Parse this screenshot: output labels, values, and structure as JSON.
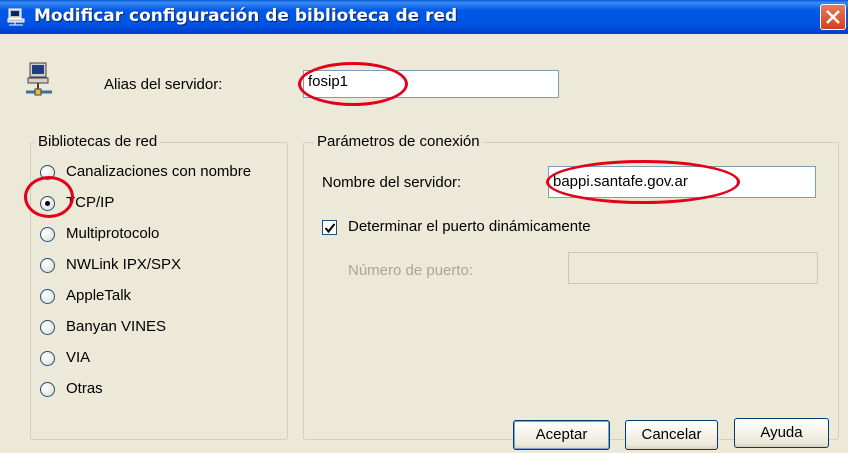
{
  "window": {
    "title": "Modificar configuración de biblioteca de red"
  },
  "alias": {
    "label": "Alias del servidor:",
    "value": "fosip1"
  },
  "libraries": {
    "legend": "Bibliotecas de red",
    "options": [
      {
        "label": "Canalizaciones con nombre",
        "selected": false
      },
      {
        "label": "TCP/IP",
        "selected": true
      },
      {
        "label": "Multiprotocolo",
        "selected": false
      },
      {
        "label": "NWLink IPX/SPX",
        "selected": false
      },
      {
        "label": "AppleTalk",
        "selected": false
      },
      {
        "label": "Banyan VINES",
        "selected": false
      },
      {
        "label": "VIA",
        "selected": false
      },
      {
        "label": "Otras",
        "selected": false
      }
    ]
  },
  "connection": {
    "legend": "Parámetros de conexión",
    "server_name_label": "Nombre del servidor:",
    "server_name_value": "bappi.santafe.gov.ar",
    "dynamic_port_label": "Determinar el puerto dinámicamente",
    "dynamic_port_checked": true,
    "port_label": "Número de puerto:",
    "port_value": ""
  },
  "buttons": {
    "ok": "Aceptar",
    "cancel": "Cancelar",
    "help": "Ayuda"
  },
  "colors": {
    "titlebar": "#0054e3",
    "annotation": "#e3001b",
    "window_bg": "#ece9d8"
  }
}
